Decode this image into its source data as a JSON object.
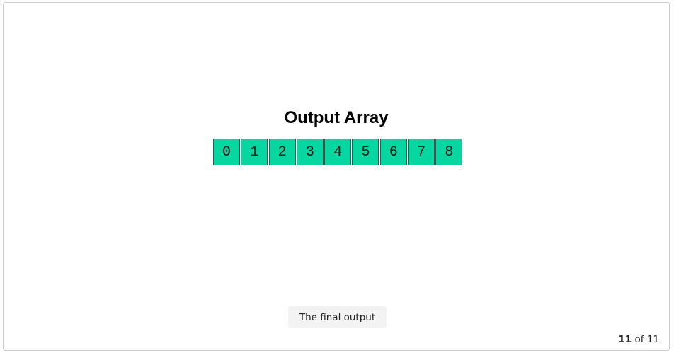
{
  "slide": {
    "title": "Output Array",
    "array_values": [
      "0",
      "1",
      "2",
      "3",
      "4",
      "5",
      "6",
      "7",
      "8"
    ],
    "caption": "The final output"
  },
  "pager": {
    "current": "11",
    "separator": "of",
    "total": "11"
  },
  "colors": {
    "cell_fill": "#06d6a0",
    "cell_border": "#2c5f4f",
    "caption_bg": "#f3f3f3",
    "frame_border": "#cccccc"
  }
}
